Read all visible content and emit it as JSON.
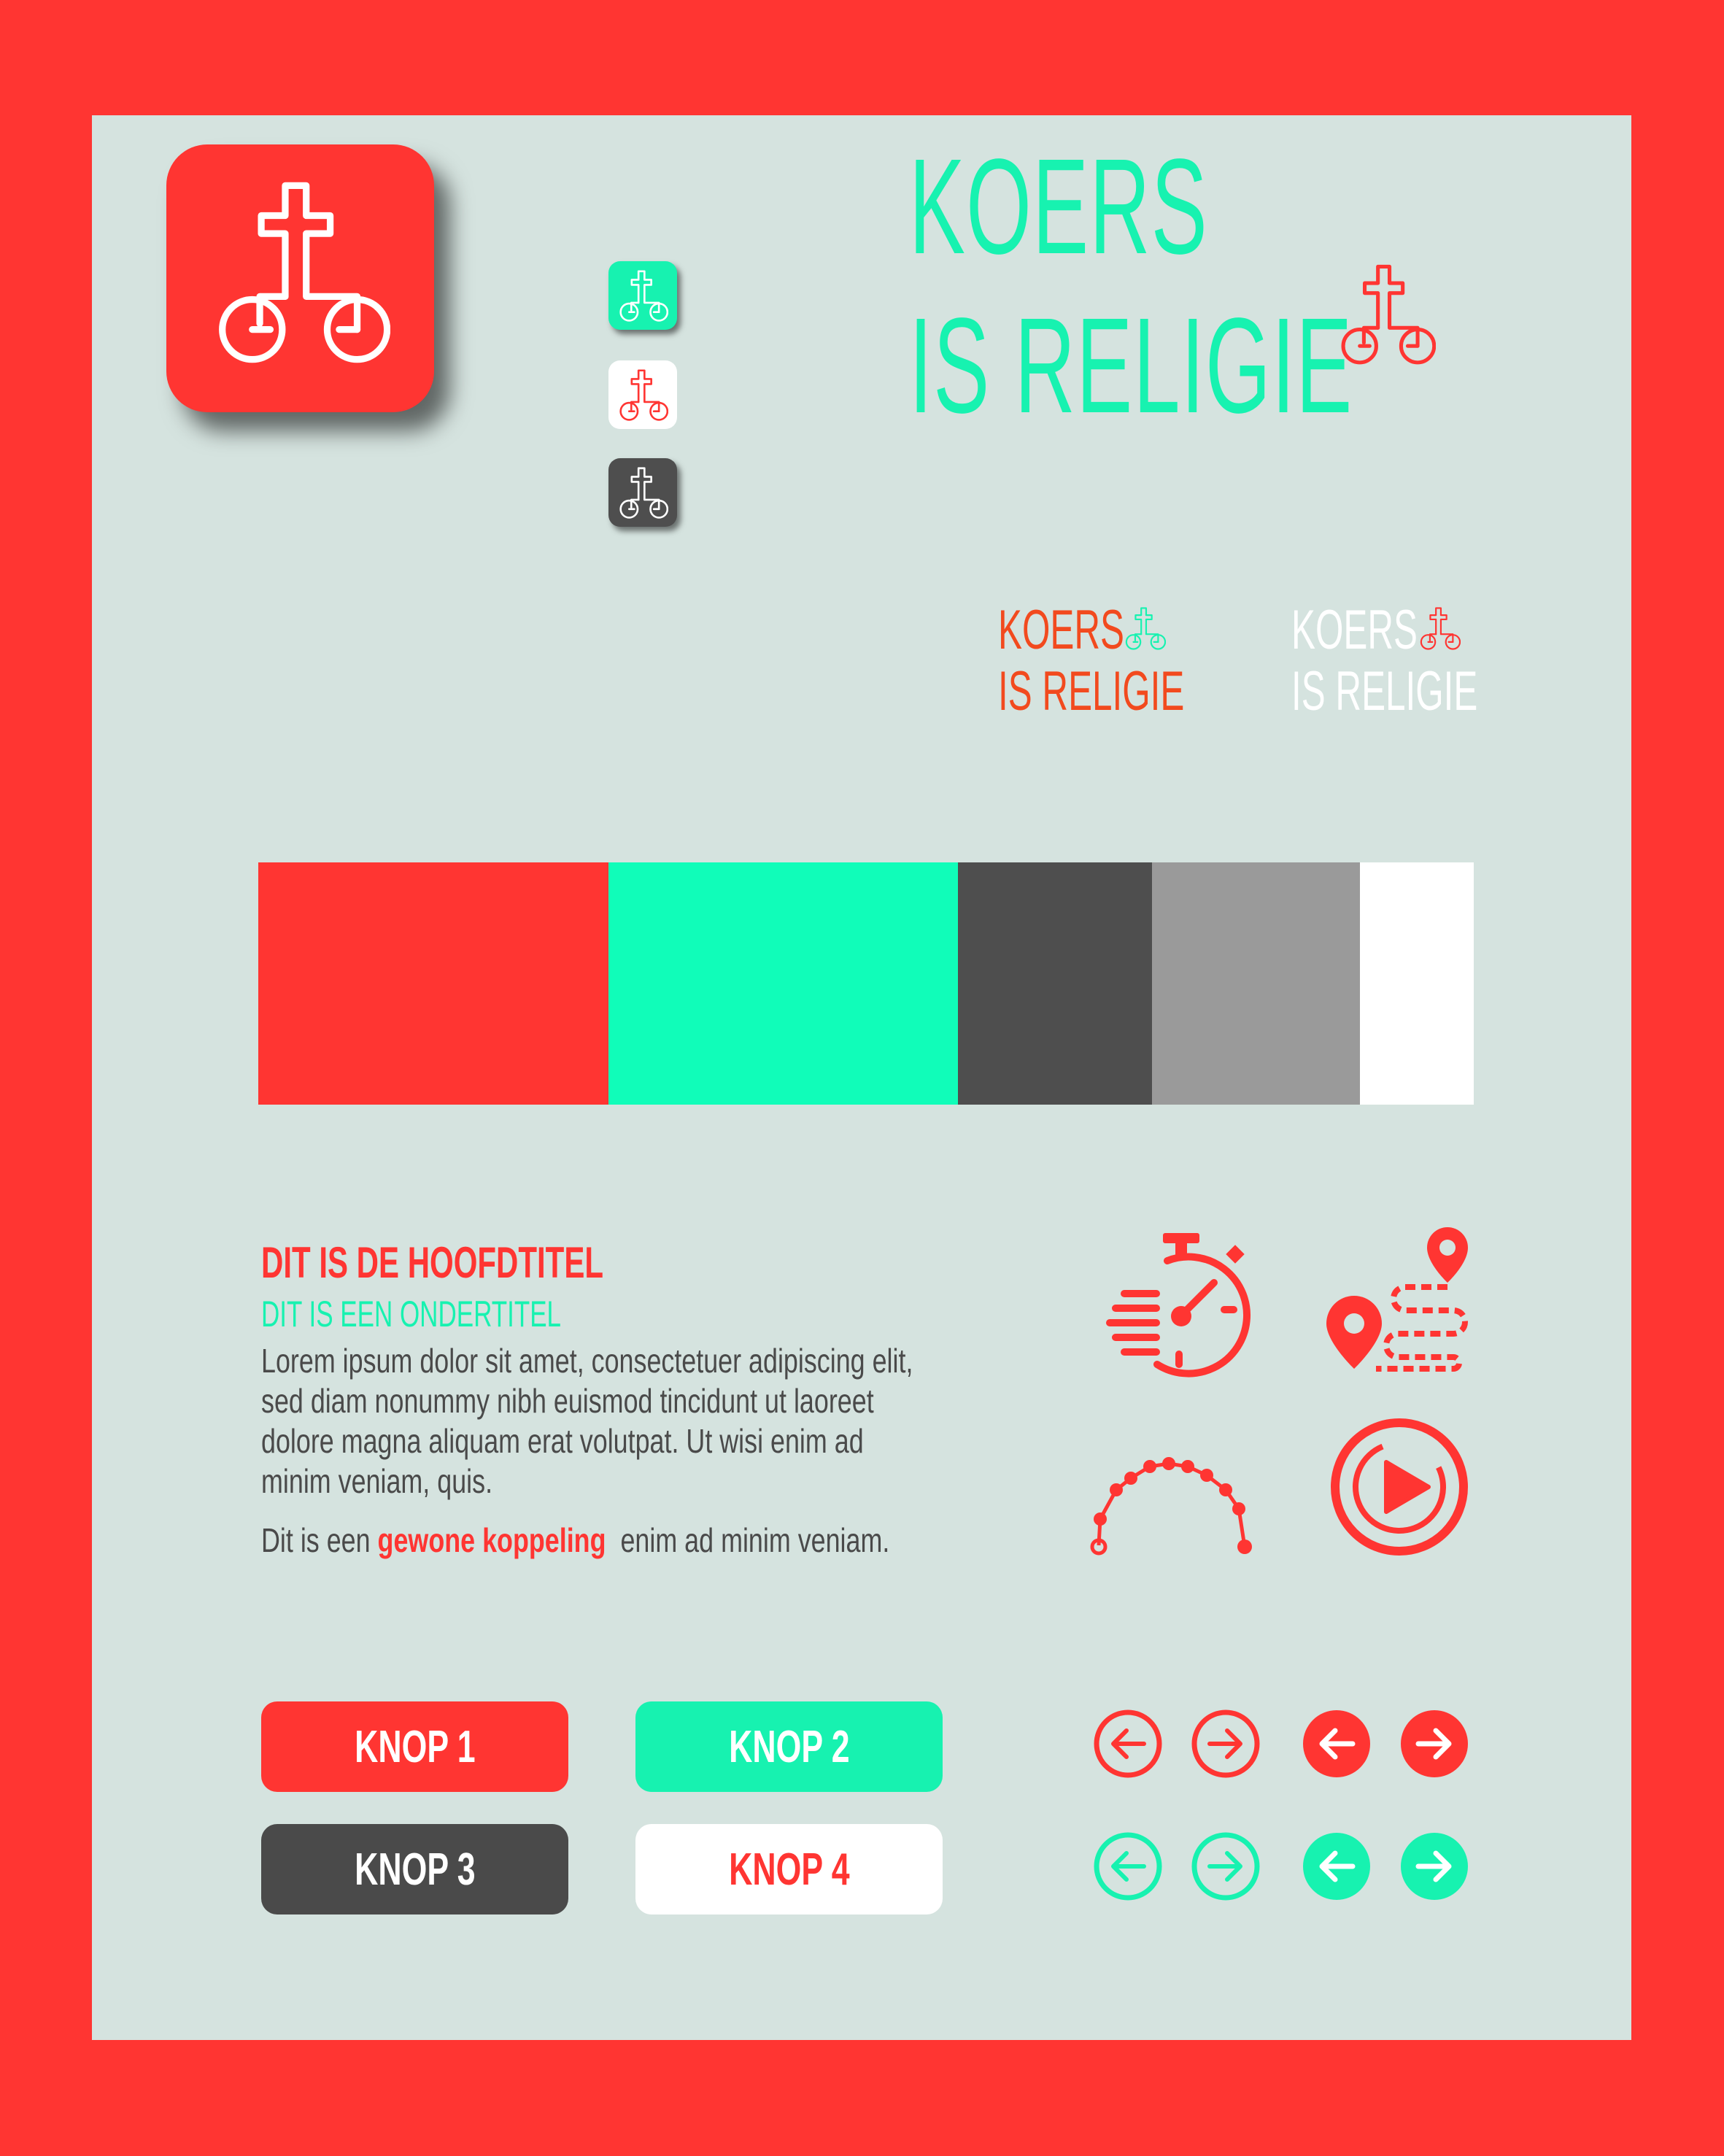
{
  "brand": {
    "name_line1": "KOERS",
    "name_line2": "IS RELIGIE",
    "logo_icon": "cross-bicycle-icon"
  },
  "colors": {
    "red": "#FF3532",
    "green": "#17F2B0",
    "dark": "#4E4E4E",
    "gray": "#9A9A9A",
    "white": "#FFFFFF",
    "background": "#D5E3DF",
    "text": "#4A4A4A"
  },
  "palette": [
    "#FF3532",
    "#10FDB9",
    "#4E4E4E",
    "#9A9A9A",
    "#FFFFFF"
  ],
  "typography": {
    "heading": "DIT IS DE HOOFDTITEL",
    "subheading": "DIT IS EEN ONDERTITEL",
    "body": [
      "Lorem ipsum dolor sit amet, consectetuer adipiscing elit,",
      "sed diam nonummy nibh euismod tincidunt ut laoreet",
      "dolore magna aliquam erat volutpat. Ut wisi enim ad",
      "minim veniam, quis."
    ],
    "link_prefix": "Dit is een",
    "link_text": "gewone koppeling",
    "link_suffix": "enim ad minim veniam."
  },
  "icons": [
    "stopwatch-icon",
    "route-map-icon",
    "elevation-route-icon",
    "play-button-icon"
  ],
  "buttons": [
    {
      "label": "KNOP 1"
    },
    {
      "label": "KNOP 2"
    },
    {
      "label": "KNOP 3"
    },
    {
      "label": "KNOP 4"
    }
  ],
  "nav_buttons": [
    "arrow-left-outline-icon",
    "arrow-right-outline-icon",
    "arrow-left-filled-icon",
    "arrow-right-filled-icon"
  ]
}
